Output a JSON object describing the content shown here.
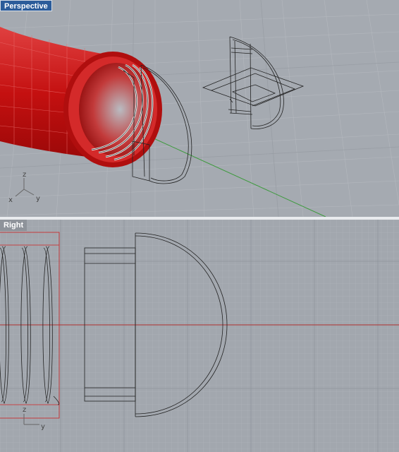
{
  "viewports": {
    "perspective": {
      "title": "Perspective"
    },
    "right": {
      "title": "Right"
    }
  },
  "axis_gizmo": {
    "x": "x",
    "y": "y",
    "z": "z"
  },
  "colors": {
    "tube_red": "#cc1515",
    "grid_axis_red": "#b03030",
    "grid_axis_green": "#3c9a3c",
    "active_tab": "#2b5c9a",
    "wire": "#202020"
  }
}
